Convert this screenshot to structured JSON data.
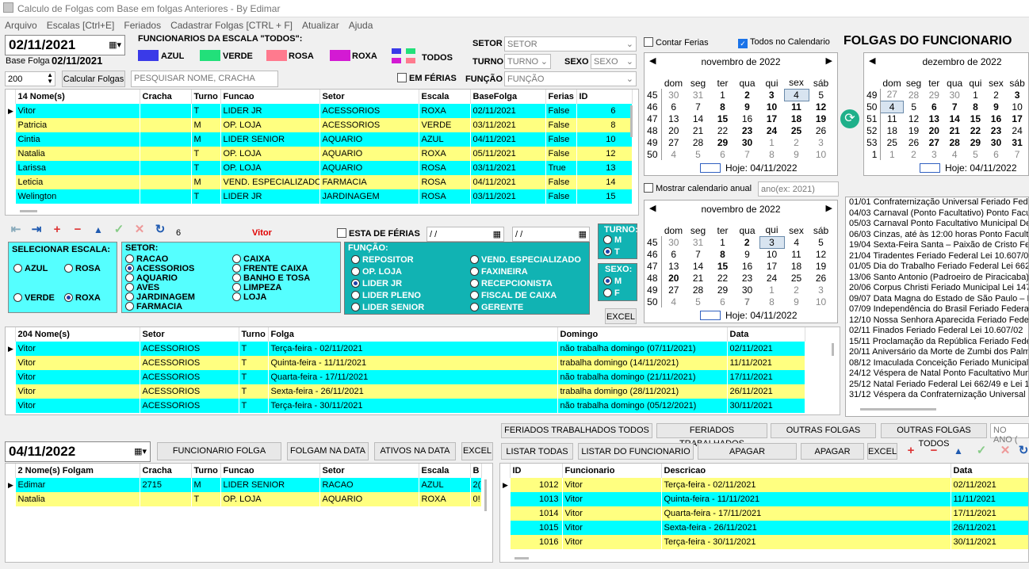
{
  "app": {
    "title": "Calculo de Folgas com Base em folgas Anteriores - By Edimar"
  },
  "menu": [
    "Arquivo",
    "Escalas [Ctrl+E]",
    "Feriados",
    "Cadastrar Folgas [CTRL + F]",
    "Atualizar",
    "Ajuda"
  ],
  "top": {
    "date": "02/11/2021",
    "base_folga_label": "Base Folga",
    "base_folga": "02/11/2021",
    "spin_value": "200",
    "calc_button": "Calcular Folgas",
    "search_placeholder": "PESQUISAR NOME, CRACHA",
    "escala_heading": "FUNCIONARIOS DA ESCALA  \"TODOS\":"
  },
  "legend": [
    {
      "label": "AZUL",
      "color": "#3a3ae8"
    },
    {
      "label": "VERDE",
      "color": "#22e07a"
    },
    {
      "label": "ROSA",
      "color": "#ff7a8e"
    },
    {
      "label": "ROXA",
      "color": "#d31ad3"
    },
    {
      "label": "TODOS",
      "color": "#888888"
    }
  ],
  "filters": {
    "setor_label": "SETOR",
    "setor_value": "SETOR",
    "turno_label": "TURNO",
    "turno_value": "TURNO",
    "sexo_label": "SEXO",
    "sexo_value": "SEXO",
    "funcao_label": "FUNÇÃO",
    "funcao_value": "FUNÇÃO",
    "em_ferias": "EM FÉRIAS",
    "contar_ferias": "Contar Ferias",
    "todos_calendario": "Todos  no Calendario",
    "mostrar_anual": "Mostrar calendario anual",
    "ano_placeholder": "ano(ex: 2021)"
  },
  "folgas_heading": "FOLGAS DO FUNCIONARIO",
  "employees": {
    "headers": [
      "14 Nome(s)",
      "Cracha",
      "Turno",
      "Funcao",
      "Setor",
      "Escala",
      "BaseFolga",
      "Ferias",
      "ID"
    ],
    "rows": [
      {
        "nome": "Vitor",
        "cracha": "",
        "turno": "T",
        "funcao": "LIDER JR",
        "setor": "ACESSORIOS",
        "escala": "ROXA",
        "base": "02/11/2021",
        "ferias": "False",
        "id": "6"
      },
      {
        "nome": "Patricia",
        "cracha": "",
        "turno": "M",
        "funcao": "OP. LOJA",
        "setor": "ACESSORIOS",
        "escala": "VERDE",
        "base": "03/11/2021",
        "ferias": "False",
        "id": "8"
      },
      {
        "nome": "Cintia",
        "cracha": "",
        "turno": "M",
        "funcao": "LIDER SENIOR",
        "setor": "AQUARIO",
        "escala": "AZUL",
        "base": "04/11/2021",
        "ferias": "False",
        "id": "10"
      },
      {
        "nome": "Natalia",
        "cracha": "",
        "turno": "T",
        "funcao": "OP. LOJA",
        "setor": "AQUARIO",
        "escala": "ROXA",
        "base": "05/11/2021",
        "ferias": "False",
        "id": "12"
      },
      {
        "nome": "Larissa",
        "cracha": "",
        "turno": "T",
        "funcao": "OP. LOJA",
        "setor": "AQUARIO",
        "escala": "ROSA",
        "base": "03/11/2021",
        "ferias": "True",
        "id": "13"
      },
      {
        "nome": "Leticia",
        "cracha": "",
        "turno": "M",
        "funcao": "VEND. ESPECIALIZADO",
        "setor": "FARMACIA",
        "escala": "ROSA",
        "base": "04/11/2021",
        "ferias": "False",
        "id": "14"
      },
      {
        "nome": "Welington",
        "cracha": "",
        "turno": "T",
        "funcao": "LIDER JR",
        "setor": "JARDINAGEM",
        "escala": "ROSA",
        "base": "03/11/2021",
        "ferias": "False",
        "id": "15"
      }
    ]
  },
  "nav": {
    "count": "6",
    "selected_name": "Vitor",
    "esta_ferias": "ESTA DE FÉRIAS",
    "date1": " / /",
    "date2": " / /"
  },
  "escala_sel": {
    "title": "SELECIONAR ESCALA:",
    "options": [
      "AZUL",
      "ROSA",
      "VERDE",
      "ROXA"
    ]
  },
  "setor_sel": {
    "title": "SETOR:",
    "col1": [
      "RACAO",
      "ACESSORIOS",
      "AQUARIO",
      "AVES",
      "JARDINAGEM",
      "FARMACIA"
    ],
    "col2": [
      "CAIXA",
      "FRENTE CAIXA",
      "BANHO E TOSA",
      "LIMPEZA",
      "LOJA"
    ]
  },
  "funcao_sel": {
    "title": "FUNÇÃO:",
    "col1": [
      "REPOSITOR",
      "OP. LOJA",
      "LIDER JR",
      "LIDER PLENO",
      "LIDER SENIOR"
    ],
    "col2": [
      "VEND. ESPECIALIZADO",
      "FAXINEIRA",
      "RECEPCIONISTA",
      "FISCAL DE CAIXA",
      "GERENTE"
    ]
  },
  "turno_sel": {
    "title": "TURNO:",
    "options": [
      "M",
      "T"
    ]
  },
  "sexo_sel": {
    "title": "SEXO:",
    "options": [
      "M",
      "F"
    ]
  },
  "excel": "EXCEL",
  "folgas": {
    "headers": [
      "204 Nome(s)",
      "Setor",
      "Turno",
      "Folga",
      "Domingo",
      "Data"
    ],
    "rows": [
      {
        "nome": "Vitor",
        "setor": "ACESSORIOS",
        "turno": "T",
        "folga": "Terça-feira - 02/11/2021",
        "domingo": "não trabalha domingo  (07/11/2021)",
        "data": "02/11/2021"
      },
      {
        "nome": "Vitor",
        "setor": "ACESSORIOS",
        "turno": "T",
        "folga": "Quinta-feira - 11/11/2021",
        "domingo": "trabalha domingo  (14/11/2021)",
        "data": "11/11/2021"
      },
      {
        "nome": "Vitor",
        "setor": "ACESSORIOS",
        "turno": "T",
        "folga": "Quarta-feira - 17/11/2021",
        "domingo": "não trabalha domingo  (21/11/2021)",
        "data": "17/11/2021"
      },
      {
        "nome": "Vitor",
        "setor": "ACESSORIOS",
        "turno": "T",
        "folga": "Sexta-feira - 26/11/2021",
        "domingo": "trabalha domingo  (28/11/2021)",
        "data": "26/11/2021"
      },
      {
        "nome": "Vitor",
        "setor": "ACESSORIOS",
        "turno": "T",
        "folga": "Terça-feira - 30/11/2021",
        "domingo": "não trabalha domingo  (05/12/2021)",
        "data": "30/11/2021"
      }
    ]
  },
  "calendars": {
    "weekdays": [
      "dom",
      "seg",
      "ter",
      "qua",
      "qui",
      "sex",
      "sáb"
    ],
    "hoje": "Hoje: 04/11/2022",
    "nov1": {
      "title": "novembro de 2022",
      "rows": [
        [
          "45",
          "30",
          "31",
          "1",
          "2",
          "3",
          "4",
          "5"
        ],
        [
          "46",
          "6",
          "7",
          "8",
          "9",
          "10",
          "11",
          "12"
        ],
        [
          "47",
          "13",
          "14",
          "15",
          "16",
          "17",
          "18",
          "19"
        ],
        [
          "48",
          "20",
          "21",
          "22",
          "23",
          "24",
          "25",
          "26"
        ],
        [
          "49",
          "27",
          "28",
          "29",
          "30",
          "1",
          "2",
          "3"
        ],
        [
          "50",
          "4",
          "5",
          "6",
          "7",
          "8",
          "9",
          "10"
        ]
      ]
    },
    "dec": {
      "title": "dezembro de 2022",
      "rows": [
        [
          "49",
          "27",
          "28",
          "29",
          "30",
          "1",
          "2",
          "3"
        ],
        [
          "50",
          "4",
          "5",
          "6",
          "7",
          "8",
          "9",
          "10"
        ],
        [
          "51",
          "11",
          "12",
          "13",
          "14",
          "15",
          "16",
          "17"
        ],
        [
          "52",
          "18",
          "19",
          "20",
          "21",
          "22",
          "23",
          "24"
        ],
        [
          "53",
          "25",
          "26",
          "27",
          "28",
          "29",
          "30",
          "31"
        ],
        [
          "1",
          "1",
          "2",
          "3",
          "4",
          "5",
          "6",
          "7"
        ]
      ]
    },
    "nov2": {
      "title": "novembro de 2022",
      "rows": [
        [
          "45",
          "30",
          "31",
          "1",
          "2",
          "3",
          "4",
          "5"
        ],
        [
          "46",
          "6",
          "7",
          "8",
          "9",
          "10",
          "11",
          "12"
        ],
        [
          "47",
          "13",
          "14",
          "15",
          "16",
          "17",
          "18",
          "19"
        ],
        [
          "48",
          "20",
          "21",
          "22",
          "23",
          "24",
          "25",
          "26"
        ],
        [
          "49",
          "27",
          "28",
          "29",
          "30",
          "1",
          "2",
          "3"
        ],
        [
          "50",
          "4",
          "5",
          "6",
          "7",
          "8",
          "9",
          "10"
        ]
      ]
    }
  },
  "feriados": [
    "01/01 Confraternização Universal Feriado Federal",
    "04/03 Carnaval (Ponto Facultativo) Ponto Facultativo",
    "05/03 Carnaval  Ponto Facultativo Municipal De",
    "06/03 Cinzas, até às 12:00 horas Ponto Facultativo",
    "19/04 Sexta-Feira Santa – Paixão de Cristo Feriado",
    "21/04 Tiradentes Feriado Federal Lei 10.607/02",
    "01/05 Dia do Trabalho Feriado Federal Lei 662/49",
    "13/06 Santo Antonio (Padroeiro de Piracicaba) Feriado",
    "20/06 Corpus Christi Feriado Municipal Lei 1470",
    "09/07 Data Magna do Estado de São Paulo – Revolução",
    "07/09 Independência do Brasil Feriado Federal Lei",
    "12/10 Nossa Senhora Aparecida Feriado Federal",
    "02/11 Finados Feriado Federal Lei 10.607/02",
    "15/11 Proclamação da República Feriado Federal",
    "20/11 Aniversário da Morte de Zumbi dos Palmares",
    "08/12 Imaculada Conceição Feriado Municipal Lei",
    "24/12 Véspera de Natal Ponto Facultativo Municipal",
    "25/12 Natal Feriado Federal Lei 662/49 e Lei 10.607",
    "31/12 Véspera da Confraternização Universal Ponto"
  ],
  "bottom_left": {
    "date": "04/11/2022",
    "buttons": [
      "FUNCIONARIO FOLGA",
      "FOLGAM NA DATA",
      "ATIVOS NA DATA",
      "EXCEL"
    ],
    "headers": [
      "2 Nome(s) Folgam",
      "Cracha",
      "Turno",
      "Funcao",
      "Setor",
      "Escala",
      "B"
    ],
    "rows": [
      {
        "nome": "Edimar",
        "cracha": "2715",
        "turno": "M",
        "funcao": "LIDER SENIOR",
        "setor": "RACAO",
        "escala": "AZUL",
        "b": "2("
      },
      {
        "nome": "Natalia",
        "cracha": "",
        "turno": "T",
        "funcao": "OP. LOJA",
        "setor": "AQUARIO",
        "escala": "ROXA",
        "b": "0!"
      }
    ]
  },
  "bottom_right": {
    "tabs": [
      "FERIADOS TRABALHADOS TODOS",
      "FERIADOS TRABALHADOS",
      "OUTRAS FOLGAS",
      "OUTRAS FOLGAS TODOS"
    ],
    "no_ano": "NO ANO (",
    "buttons": [
      "LISTAR TODAS",
      "LISTAR DO FUNCIONARIO",
      "APAGAR FUNCIONARIO",
      "APAGAR TUDO",
      "EXCEL"
    ],
    "headers": [
      "ID",
      "Funcionario",
      "Descricao",
      "Data"
    ],
    "rows": [
      {
        "id": "1012",
        "func": "Vitor",
        "desc": "Terça-feira - 02/11/2021",
        "data": "02/11/2021"
      },
      {
        "id": "1013",
        "func": "Vitor",
        "desc": "Quinta-feira - 11/11/2021",
        "data": "11/11/2021"
      },
      {
        "id": "1014",
        "func": "Vitor",
        "desc": "Quarta-feira - 17/11/2021",
        "data": "17/11/2021"
      },
      {
        "id": "1015",
        "func": "Vitor",
        "desc": "Sexta-feira - 26/11/2021",
        "data": "26/11/2021"
      },
      {
        "id": "1016",
        "func": "Vitor",
        "desc": "Terça-feira - 30/11/2021",
        "data": "30/11/2021"
      }
    ]
  }
}
